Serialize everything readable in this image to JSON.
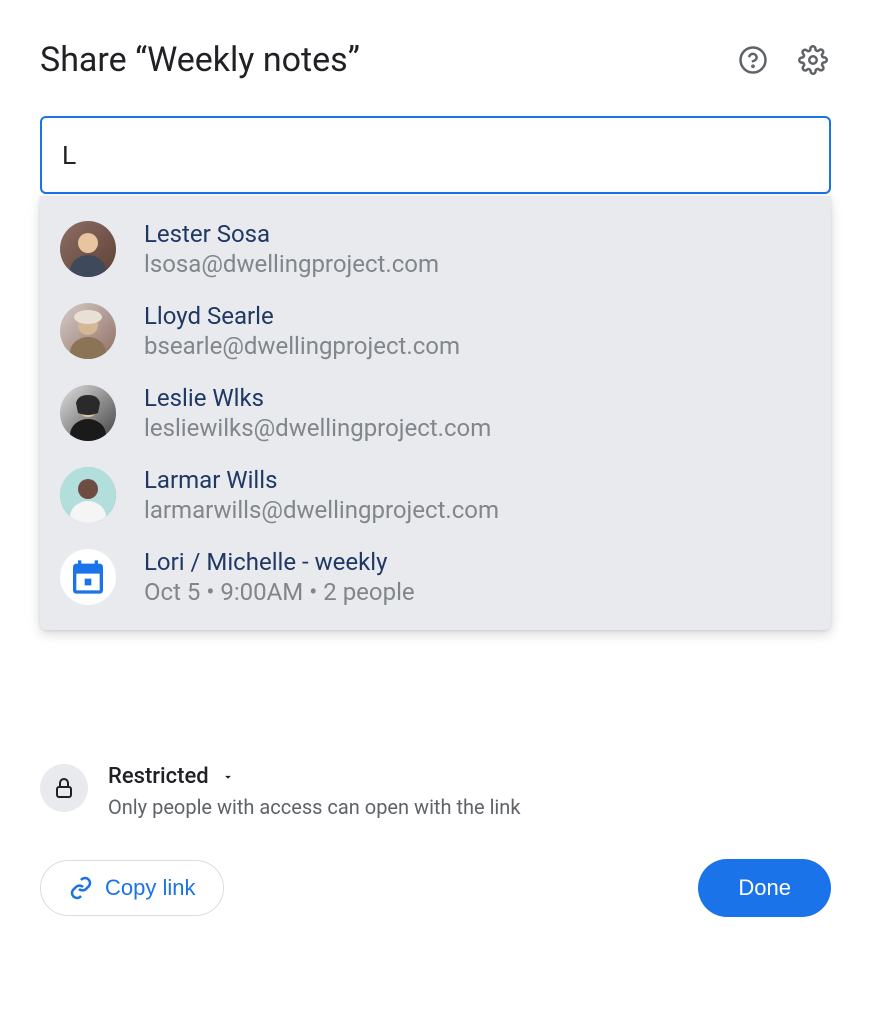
{
  "header": {
    "title": "Share “Weekly notes”"
  },
  "search": {
    "value": "L"
  },
  "suggestions": [
    {
      "name": "Lester Sosa",
      "detail": "lsosa@dwellingproject.com",
      "type": "person"
    },
    {
      "name": "Lloyd Searle",
      "detail": "bsearle@dwellingproject.com",
      "type": "person"
    },
    {
      "name": "Leslie Wlks",
      "detail": "lesliewilks@dwellingproject.com",
      "type": "person"
    },
    {
      "name": "Larmar Wills",
      "detail": "larmarwills@dwellingproject.com",
      "type": "person"
    },
    {
      "name": "Lori / Michelle - weekly",
      "detail": "Oct 5 • 9:00AM • 2 people",
      "type": "event"
    }
  ],
  "access": {
    "label": "Restricted",
    "description": "Only people with access can open with the link"
  },
  "footer": {
    "copy_link": "Copy link",
    "done": "Done"
  }
}
